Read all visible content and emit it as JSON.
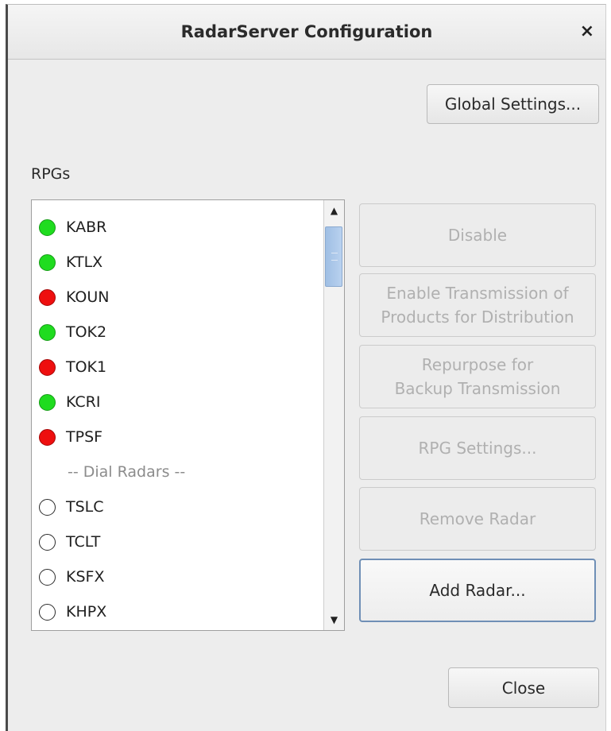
{
  "window": {
    "title": "RadarServer Configuration",
    "close_glyph": "×"
  },
  "buttons": {
    "global_settings": "Global Settings...",
    "disable": "Disable",
    "enable_transmission_line1": "Enable Transmission of",
    "enable_transmission_line2": "Products for Distribution",
    "repurpose_line1": "Repurpose for",
    "repurpose_line2": "Backup Transmission",
    "rpg_settings": "RPG Settings...",
    "remove_radar": "Remove Radar",
    "add_radar": "Add Radar...",
    "close": "Close"
  },
  "rpgs": {
    "label": "RPGs",
    "items": [
      {
        "name": "KABR",
        "status": "green"
      },
      {
        "name": "KTLX",
        "status": "green"
      },
      {
        "name": "KOUN",
        "status": "red"
      },
      {
        "name": "TOK2",
        "status": "green"
      },
      {
        "name": "TOK1",
        "status": "red"
      },
      {
        "name": "KCRI",
        "status": "green"
      },
      {
        "name": "TPSF",
        "status": "red"
      }
    ],
    "separator": "-- Dial Radars --",
    "dial_items": [
      {
        "name": "TSLC",
        "status": "none"
      },
      {
        "name": "TCLT",
        "status": "none"
      },
      {
        "name": "KSFX",
        "status": "none"
      },
      {
        "name": "KHPX",
        "status": "none"
      }
    ]
  },
  "colors": {
    "status_green": "#1fdc1f",
    "status_red": "#ee0f0f",
    "scroll_thumb": "#a9c6ea",
    "focus_border": "#6f8fb6"
  },
  "icons": {
    "close": "close-icon",
    "scroll_up": "arrow-up-icon",
    "scroll_down": "arrow-down-icon"
  }
}
